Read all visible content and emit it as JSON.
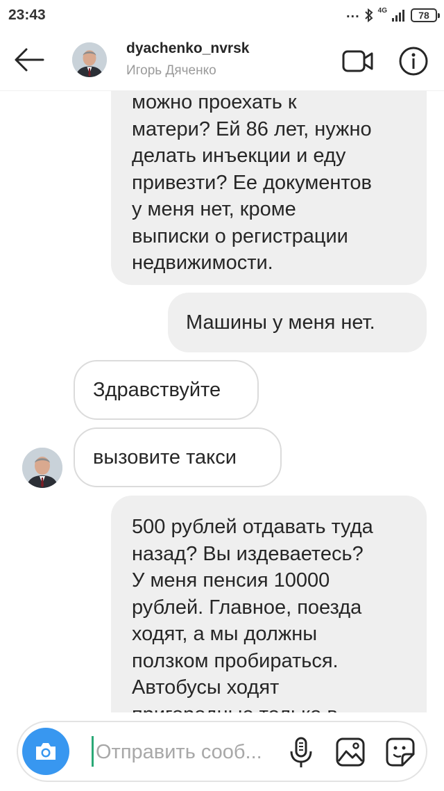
{
  "status_bar": {
    "time": "23:43",
    "dots": "...",
    "network": "4G",
    "battery": "78"
  },
  "header": {
    "username": "dyachenko_nvrsk",
    "full_name": "Игорь Дяченко",
    "back_icon": "arrow-left-icon",
    "video_icon": "video-camera-icon",
    "info_icon": "info-icon"
  },
  "messages": [
    {
      "side": "outgoing",
      "lines": [
        "можно проехать к",
        "матери? Ей 86 лет, нужно",
        "делать инъекции и еду",
        "привезти? Ее документов",
        "у меня нет, кроме",
        "выписки о регистрации",
        "недвижимости."
      ]
    },
    {
      "side": "outgoing",
      "text": "Машины у меня нет."
    },
    {
      "side": "incoming",
      "text": "Здравствуйте"
    },
    {
      "side": "incoming",
      "text": "вызовите такси"
    },
    {
      "side": "outgoing",
      "lines": [
        "500 рублей отдавать туда",
        "назад? Вы издеваетесь?",
        "У меня пенсия 10000",
        "рублей. Главное, поезда",
        "ходят, а мы должны",
        "ползком пробираться.",
        "Автобусы ходят",
        "пригородные только в"
      ]
    }
  ],
  "composer": {
    "placeholder": "Отправить сооб...",
    "camera_icon": "camera-icon",
    "mic_icon": "microphone-icon",
    "gallery_icon": "gallery-icon",
    "sticker_icon": "sticker-icon"
  },
  "colors": {
    "accent": "#3897f0",
    "outgoing_bubble": "#efefef",
    "incoming_border": "#dbdbdb",
    "caret": "#2aa876"
  }
}
